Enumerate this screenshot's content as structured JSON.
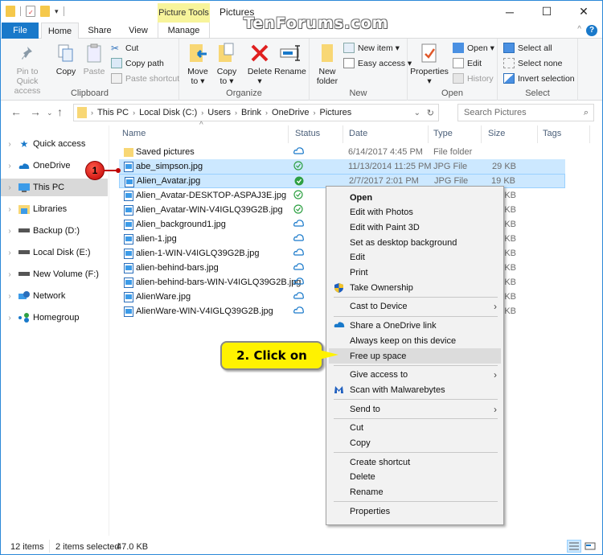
{
  "window": {
    "title": "Pictures",
    "contextual_tab_group": "Picture Tools",
    "watermark": "TenForums.com",
    "controls": {
      "minimize": "─",
      "maximize": "☐",
      "close": "✕"
    }
  },
  "ribbon_tabs": [
    "File",
    "Home",
    "Share",
    "View",
    "Manage"
  ],
  "ribbon": {
    "clipboard": {
      "label": "Clipboard",
      "pin": "Pin to Quick access",
      "pin_l1": "Pin to Quick",
      "pin_l2": "access",
      "copy": "Copy",
      "paste": "Paste",
      "cut": "Cut",
      "copy_path": "Copy path",
      "paste_shortcut": "Paste shortcut"
    },
    "organize": {
      "label": "Organize",
      "move_l1": "Move",
      "move_l2": "to ▾",
      "copy_l1": "Copy",
      "copy_l2": "to ▾",
      "delete_l1": "Delete",
      "delete_l2": "▾",
      "rename": "Rename"
    },
    "new": {
      "label": "New",
      "folder_l1": "New",
      "folder_l2": "folder",
      "new_item": "New item ▾",
      "easy_access": "Easy access ▾"
    },
    "open": {
      "label": "Open",
      "properties_l1": "Properties",
      "properties_l2": "▾",
      "open": "Open ▾",
      "edit": "Edit",
      "history": "History"
    },
    "select": {
      "label": "Select",
      "select_all": "Select all",
      "select_none": "Select none",
      "invert": "Invert selection"
    }
  },
  "address": {
    "breadcrumb": [
      "This PC",
      "Local Disk (C:)",
      "Users",
      "Brink",
      "OneDrive",
      "Pictures"
    ],
    "search_placeholder": "Search Pictures"
  },
  "sidebar": {
    "items": [
      {
        "label": "Quick access",
        "icon": "star-icon"
      },
      {
        "label": "OneDrive",
        "icon": "cloud-icon"
      },
      {
        "label": "This PC",
        "icon": "computer-icon",
        "selected": true
      },
      {
        "label": "Libraries",
        "icon": "libraries-icon"
      },
      {
        "label": "Backup (D:)",
        "icon": "drive-icon"
      },
      {
        "label": "Local Disk (E:)",
        "icon": "drive-icon"
      },
      {
        "label": "New Volume (F:)",
        "icon": "drive-icon"
      },
      {
        "label": "Network",
        "icon": "network-icon"
      },
      {
        "label": "Homegroup",
        "icon": "homegroup-icon"
      }
    ]
  },
  "columns": [
    "Name",
    "Status",
    "Date",
    "Type",
    "Size",
    "Tags"
  ],
  "files": [
    {
      "name": "Saved pictures",
      "status": "cloud",
      "date": "6/14/2017 4:45 PM",
      "type": "File folder",
      "size": "",
      "folder": true
    },
    {
      "name": "abe_simpson.jpg",
      "status": "available",
      "date": "11/13/2014 11:25 PM",
      "type": "JPG File",
      "size": "29 KB",
      "selected": true
    },
    {
      "name": "Alien_Avatar.jpg",
      "status": "always",
      "date": "2/7/2017 2:01 PM",
      "type": "JPG File",
      "size": "19 KB",
      "selected": true
    },
    {
      "name": "Alien_Avatar-DESKTOP-ASPAJ3E.jpg",
      "status": "available",
      "date": "",
      "type": "",
      "size": "19 KB"
    },
    {
      "name": "Alien_Avatar-WIN-V4IGLQ39G2B.jpg",
      "status": "available",
      "date": "",
      "type": "",
      "size": "19 KB"
    },
    {
      "name": "Alien_background1.jpg",
      "status": "cloud",
      "date": "",
      "type": "",
      "size": "166 KB"
    },
    {
      "name": "alien-1.jpg",
      "status": "cloud",
      "date": "",
      "type": "",
      "size": "9 KB"
    },
    {
      "name": "alien-1-WIN-V4IGLQ39G2B.jpg",
      "status": "cloud",
      "date": "",
      "type": "",
      "size": "9 KB"
    },
    {
      "name": "alien-behind-bars.jpg",
      "status": "cloud",
      "date": "",
      "type": "",
      "size": "43 KB"
    },
    {
      "name": "alien-behind-bars-WIN-V4IGLQ39G2B.jpg",
      "status": "cloud",
      "date": "",
      "type": "",
      "size": "43 KB"
    },
    {
      "name": "AlienWare.jpg",
      "status": "cloud",
      "date": "",
      "type": "",
      "size": "1,138 KB"
    },
    {
      "name": "AlienWare-WIN-V4IGLQ39G2B.jpg",
      "status": "cloud",
      "date": "",
      "type": "",
      "size": "1,138 KB"
    }
  ],
  "context_menu": {
    "items": [
      {
        "label": "Open",
        "bold": true
      },
      {
        "label": "Edit with Photos"
      },
      {
        "label": "Edit with Paint 3D"
      },
      {
        "label": "Set as desktop background"
      },
      {
        "label": "Edit"
      },
      {
        "label": "Print"
      },
      {
        "label": "Take Ownership",
        "icon": "shield-icon"
      },
      {
        "sep": true
      },
      {
        "label": "Cast to Device",
        "submenu": true
      },
      {
        "sep": true
      },
      {
        "label": "Share a OneDrive link",
        "icon": "onedrive-icon"
      },
      {
        "label": "Always keep on this device"
      },
      {
        "label": "Free up space",
        "highlighted": true
      },
      {
        "sep": true
      },
      {
        "label": "Give access to",
        "submenu": true
      },
      {
        "label": "Scan with Malwarebytes",
        "icon": "malwarebytes-icon"
      },
      {
        "sep": true
      },
      {
        "label": "Send to",
        "submenu": true
      },
      {
        "sep": true
      },
      {
        "label": "Cut"
      },
      {
        "label": "Copy"
      },
      {
        "sep": true
      },
      {
        "label": "Create shortcut"
      },
      {
        "label": "Delete"
      },
      {
        "label": "Rename"
      },
      {
        "sep": true
      },
      {
        "label": "Properties"
      }
    ]
  },
  "annotations": {
    "step1": "1",
    "step2": "2. Click on"
  },
  "statusbar": {
    "count": "12 items",
    "selected": "2 items selected",
    "size": "47.0 KB"
  },
  "colors": {
    "accent": "#1979ca",
    "selection": "#cce8ff",
    "callout": "#fff200",
    "badge": "#c00000"
  }
}
